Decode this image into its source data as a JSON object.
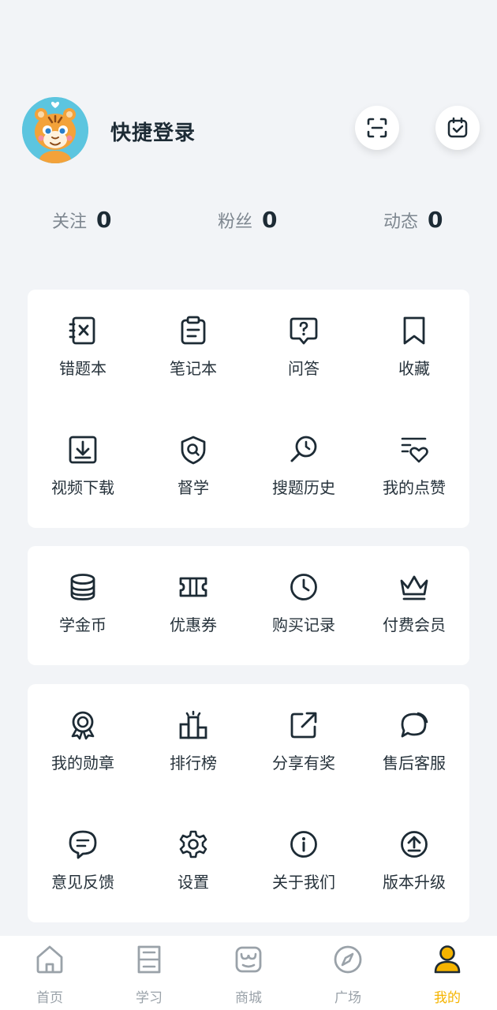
{
  "profile": {
    "login_label": "快捷登录",
    "scan_icon": "scan-icon",
    "calendar_icon": "calendar-check-icon"
  },
  "stats": [
    {
      "label": "关注",
      "value": "0"
    },
    {
      "label": "粉丝",
      "value": "0"
    },
    {
      "label": "动态",
      "value": "0"
    }
  ],
  "card1": [
    {
      "label": "错题本",
      "icon": "wrong-notebook-icon"
    },
    {
      "label": "笔记本",
      "icon": "notebook-icon"
    },
    {
      "label": "问答",
      "icon": "question-icon"
    },
    {
      "label": "收藏",
      "icon": "bookmark-icon"
    },
    {
      "label": "视频下载",
      "icon": "download-icon"
    },
    {
      "label": "督学",
      "icon": "shield-search-icon"
    },
    {
      "label": "搜题历史",
      "icon": "search-history-icon"
    },
    {
      "label": "我的点赞",
      "icon": "like-icon"
    }
  ],
  "card2": [
    {
      "label": "学金币",
      "icon": "coins-icon"
    },
    {
      "label": "优惠券",
      "icon": "coupon-icon"
    },
    {
      "label": "购买记录",
      "icon": "clock-icon"
    },
    {
      "label": "付费会员",
      "icon": "crown-icon"
    }
  ],
  "card3": [
    {
      "label": "我的勋章",
      "icon": "medal-icon"
    },
    {
      "label": "排行榜",
      "icon": "ranking-icon"
    },
    {
      "label": "分享有奖",
      "icon": "share-icon"
    },
    {
      "label": "售后客服",
      "icon": "chat-icon"
    },
    {
      "label": "意见反馈",
      "icon": "feedback-icon"
    },
    {
      "label": "设置",
      "icon": "gear-icon"
    },
    {
      "label": "关于我们",
      "icon": "info-icon"
    },
    {
      "label": "版本升级",
      "icon": "upgrade-icon"
    }
  ],
  "tabbar": [
    {
      "label": "首页",
      "icon": "home-icon"
    },
    {
      "label": "学习",
      "icon": "study-icon"
    },
    {
      "label": "商城",
      "icon": "store-icon"
    },
    {
      "label": "广场",
      "icon": "compass-icon"
    },
    {
      "label": "我的",
      "icon": "user-icon",
      "active": true
    }
  ],
  "colors": {
    "accent": "#f5b400",
    "text": "#1d2b35",
    "muted": "#7e8790",
    "background": "#f2f4f7"
  }
}
